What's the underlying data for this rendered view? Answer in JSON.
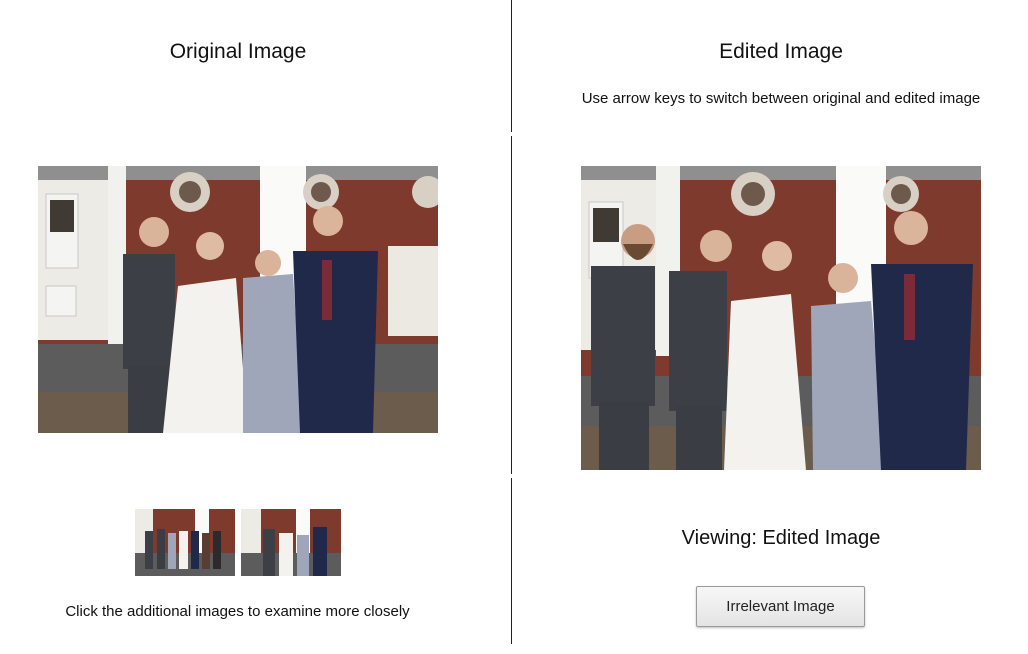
{
  "left_panel": {
    "title": "Original Image",
    "photo_icon": "family-photo-original",
    "thumbnails": [
      {
        "icon": "family-photo-group-thumbnail"
      },
      {
        "icon": "family-photo-couple-thumbnail"
      }
    ],
    "thumbnails_instruction": "Click the additional images to examine more closely"
  },
  "right_panel": {
    "title": "Edited Image",
    "instruction": "Use arrow keys to switch between original and edited image",
    "photo_icon": "family-photo-edited",
    "viewing_status": "Viewing: Edited Image",
    "irrelevant_button_label": "Irrelevant Image"
  },
  "colors": {
    "divider": "#222222",
    "brick": "#8a3b2c",
    "button_border": "#9a9a9a"
  }
}
